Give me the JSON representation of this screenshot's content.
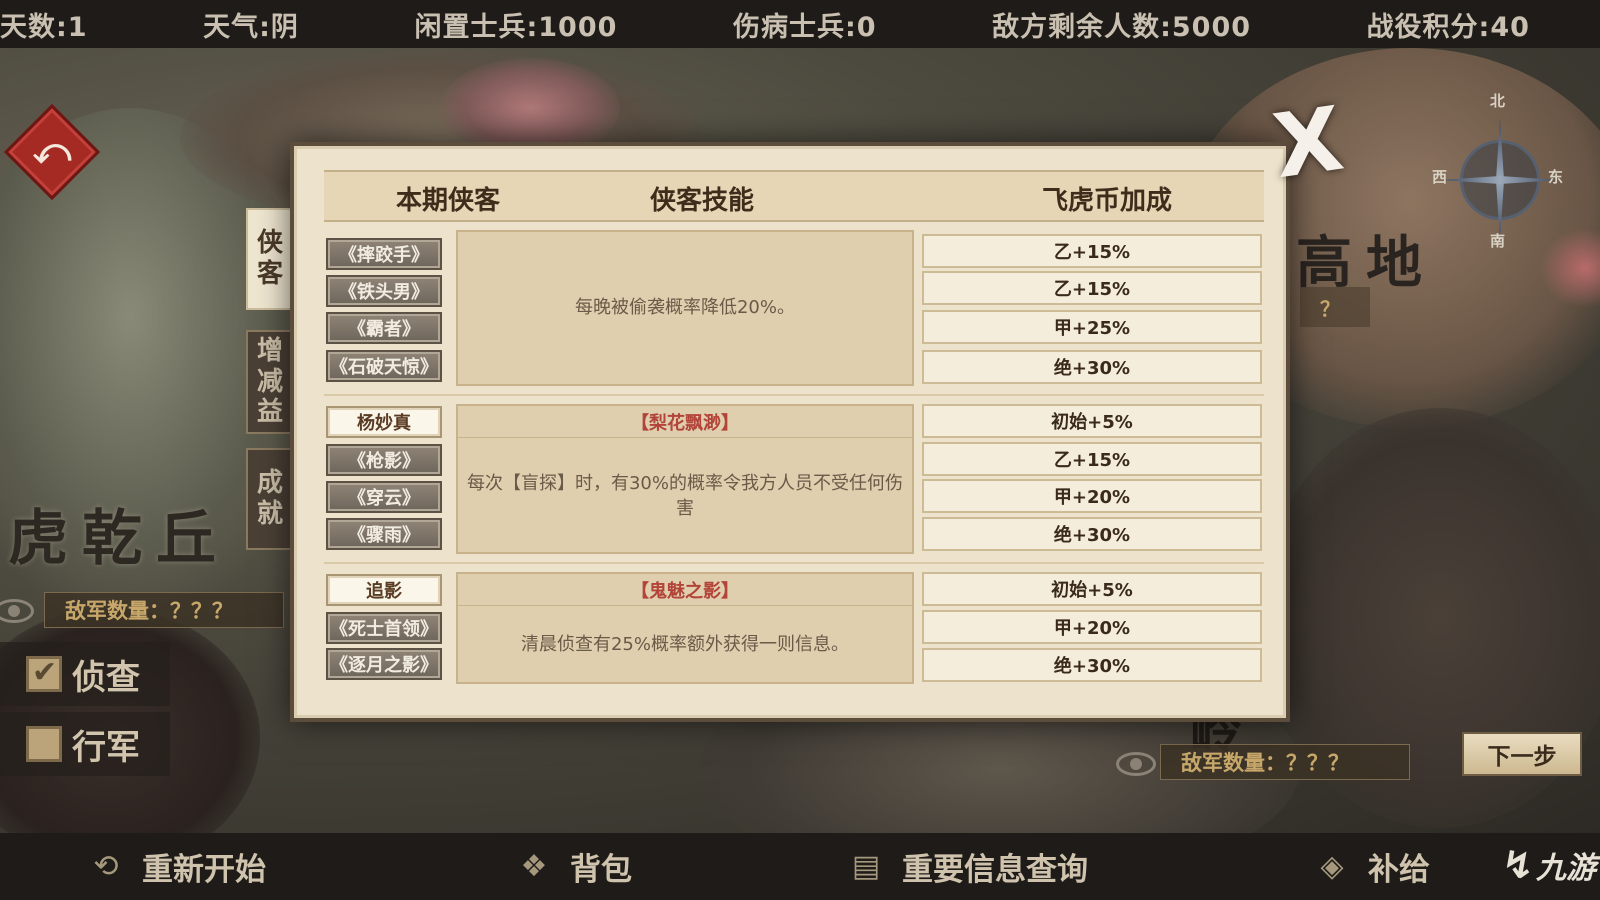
{
  "status_bar": {
    "days": "天数:1",
    "weather": "天气:阴",
    "idle_soldiers": "闲置士兵:1000",
    "wounded_soldiers": "伤病士兵:0",
    "enemy_remaining": "敌方剩余人数:5000",
    "battle_points": "战役积分:40"
  },
  "map": {
    "place_left": "虎乾丘",
    "place_right": "高地",
    "place_bottom": "岭",
    "enemy_count_left": "敌军数量：？？？",
    "enemy_count_right": "敌军数量：？？？",
    "right_unknown": "？",
    "compass": {
      "north": "北",
      "south": "南",
      "east": "东",
      "west": "西"
    },
    "scout_label": "侦查",
    "scout_checked": true,
    "march_label": "行军",
    "march_checked": false,
    "next_step": "下一步"
  },
  "side_tabs": [
    {
      "label": "侠\n客",
      "active": true
    },
    {
      "label": "增\n减\n益",
      "active": false
    },
    {
      "label": "成\n就",
      "active": false
    }
  ],
  "modal": {
    "close_symbol": "X",
    "headers": {
      "hero": "本期侠客",
      "skill": "侠客技能",
      "bonus": "飞虎币加成"
    },
    "groups": [
      {
        "items": [
          {
            "label": "《摔跤手》",
            "type": "book",
            "bonus": "乙+15%"
          },
          {
            "label": "《铁头男》",
            "type": "book",
            "bonus": "乙+15%"
          },
          {
            "label": "《霸者》",
            "type": "book",
            "bonus": "甲+25%"
          },
          {
            "label": "《石破天惊》",
            "type": "book",
            "bonus": "绝+30%"
          }
        ],
        "skill_name": "",
        "skill_desc": "每晚被偷袭概率降低20%。"
      },
      {
        "items": [
          {
            "label": "杨妙真",
            "type": "hero",
            "bonus": "初始+5%"
          },
          {
            "label": "《枪影》",
            "type": "book",
            "bonus": "乙+15%"
          },
          {
            "label": "《穿云》",
            "type": "book",
            "bonus": "甲+20%"
          },
          {
            "label": "《骤雨》",
            "type": "book",
            "bonus": "绝+30%"
          }
        ],
        "skill_name": "【梨花飘渺】",
        "skill_desc": "每次【盲探】时，有30%的概率令我方人员不受任何伤害"
      },
      {
        "items": [
          {
            "label": "追影",
            "type": "hero",
            "bonus": "初始+5%"
          },
          {
            "label": "《死士首领》",
            "type": "book",
            "bonus": "甲+20%"
          },
          {
            "label": "《逐月之影》",
            "type": "book",
            "bonus": "绝+30%"
          }
        ],
        "skill_name": "【鬼魅之影】",
        "skill_desc": "清晨侦查有25%概率额外获得一则信息。"
      }
    ]
  },
  "bottom_bar": {
    "restart": "重新开始",
    "bag": "背包",
    "info_query": "重要信息查询",
    "supply": "补给",
    "watermark": "九游"
  },
  "colors": {
    "accent_red": "#b3443a",
    "panel_bg": "#ede3cc",
    "back_button": "#a52a24"
  },
  "icons": {
    "back": "return-arrow-icon",
    "close": "close-icon",
    "eye": "eye-icon",
    "restart": "restart-icon",
    "bag": "bag-icon",
    "info": "scroll-icon",
    "supply": "supply-box-icon"
  }
}
